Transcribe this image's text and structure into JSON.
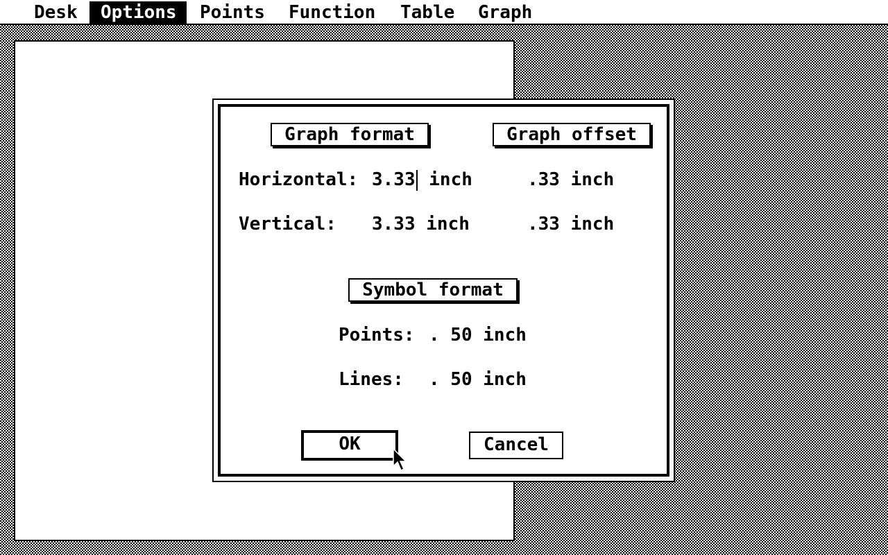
{
  "menu": {
    "items": [
      "Desk",
      "Options",
      "Points",
      "Function",
      "Table",
      "Graph"
    ],
    "active": "Options"
  },
  "dialog": {
    "graph_format_label": "Graph format",
    "graph_offset_label": "Graph offset",
    "horizontal_label": "Horizontal:",
    "horizontal_value": "3.33",
    "horizontal_unit": "inch",
    "horizontal_offset": ".33 inch",
    "vertical_label": "Vertical:",
    "vertical_value": "3.33 inch",
    "vertical_offset": ".33 inch",
    "symbol_format_label": "Symbol format",
    "points_label": "Points:",
    "points_value": ". 50 inch",
    "lines_label": "Lines:",
    "lines_value": ". 50 inch",
    "ok_label": "OK",
    "cancel_label": "Cancel"
  },
  "colors": {
    "foreground": "#000000",
    "background": "#ffffff"
  },
  "icons": {
    "pointer": "arrow-pointer-icon",
    "text_cursor": "text-cursor-icon"
  }
}
